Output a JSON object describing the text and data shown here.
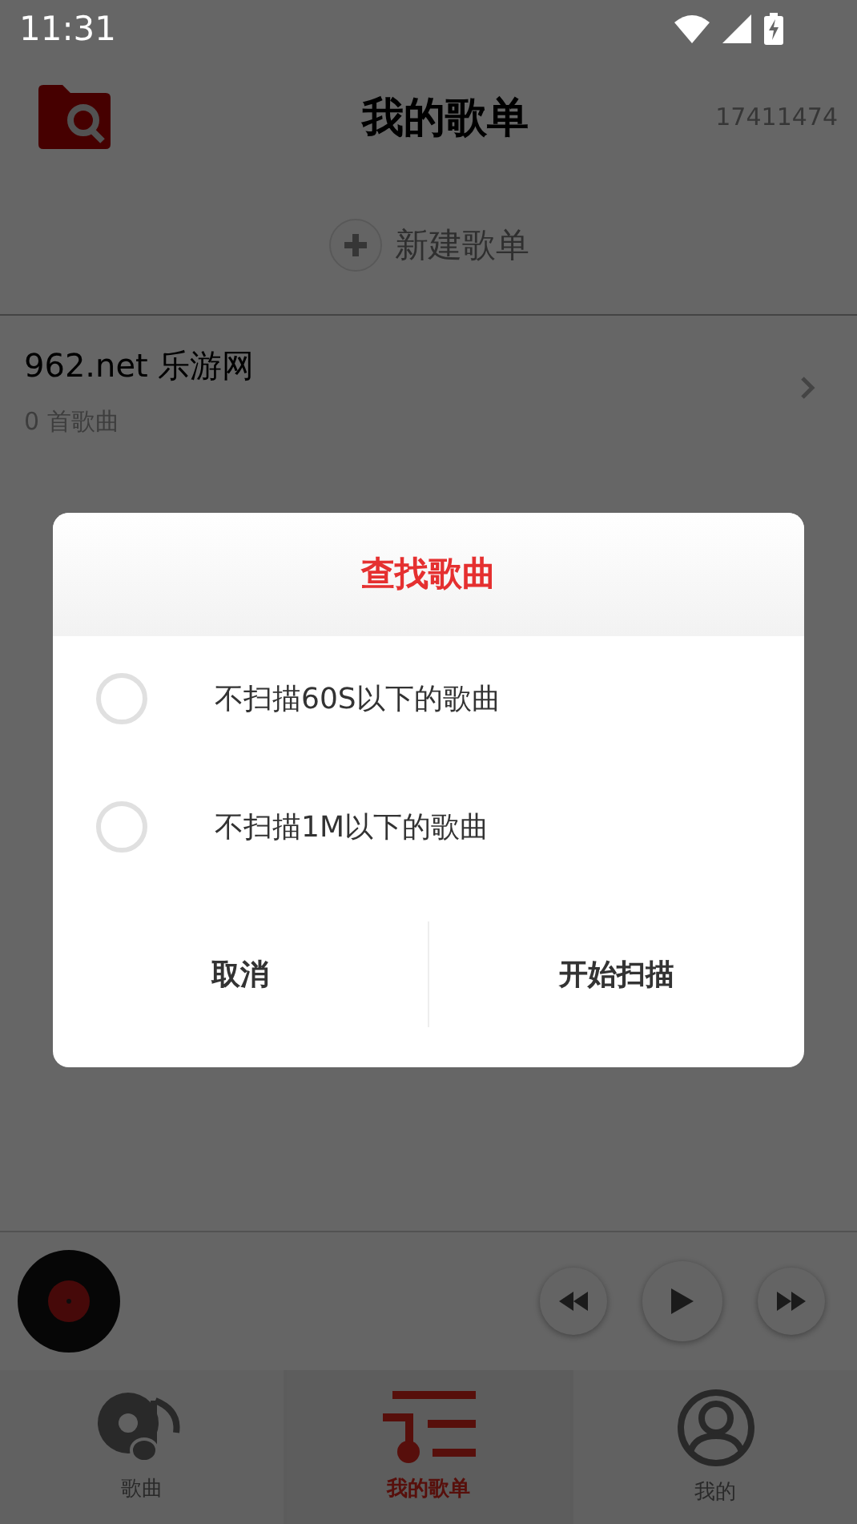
{
  "status_bar": {
    "time": "11:31"
  },
  "header": {
    "title": "我的歌单",
    "user_id": "17411474"
  },
  "new_playlist": {
    "label": "新建歌单"
  },
  "playlists": [
    {
      "name": "962.net 乐游网",
      "count": "0 首歌曲"
    }
  ],
  "tabs": [
    {
      "label": "歌曲",
      "kind": "songs",
      "selected": false
    },
    {
      "label": "我的歌单",
      "kind": "playlists",
      "selected": true
    },
    {
      "label": "我的",
      "kind": "profile",
      "selected": false
    }
  ],
  "dialog": {
    "title": "查找歌曲",
    "options": [
      {
        "label": "不扫描60S以下的歌曲",
        "checked": false
      },
      {
        "label": "不扫描1M以下的歌曲",
        "checked": false
      }
    ],
    "buttons": [
      {
        "label": "取消"
      },
      {
        "label": "开始扫描"
      }
    ]
  }
}
